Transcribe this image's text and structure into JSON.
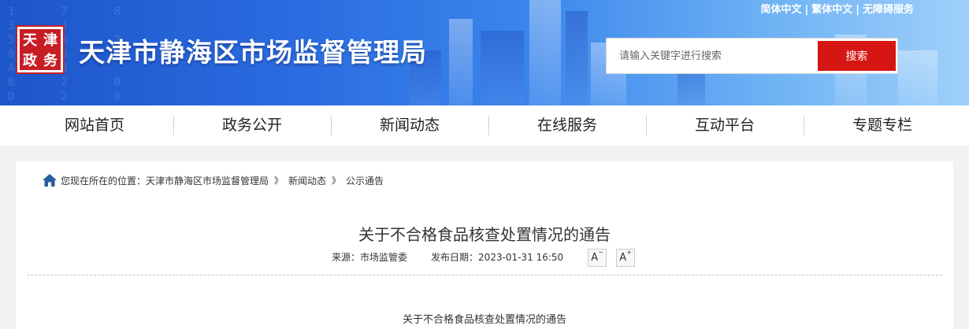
{
  "header": {
    "site_title": "天津市静海区市场监督管理局",
    "logo_chars": [
      "天",
      "津",
      "政",
      "务"
    ],
    "lang_links": [
      "简体中文",
      "繁体中文",
      "无障碍服务"
    ],
    "search": {
      "placeholder": "请输入关键字进行搜索",
      "button_label": "搜索"
    }
  },
  "nav": {
    "items": [
      "网站首页",
      "政务公开",
      "新闻动态",
      "在线服务",
      "互动平台",
      "专题专栏"
    ]
  },
  "breadcrumb": {
    "prefix": "您现在所在的位置：",
    "items": [
      "天津市静海区市场监督管理局",
      "新闻动态",
      "公示通告"
    ],
    "separator": "》"
  },
  "article": {
    "title": "关于不合格食品核查处置情况的通告",
    "source_label": "来源：",
    "source": "市场监管委",
    "date_label": "发布日期：",
    "date": "2023-01-31 16:50",
    "font_decrease": "A",
    "font_increase": "A",
    "body_title": "关于不合格食品核查处置情况的通告"
  },
  "colors": {
    "accent_red": "#d51613",
    "banner_blue": "#2a6be0"
  }
}
